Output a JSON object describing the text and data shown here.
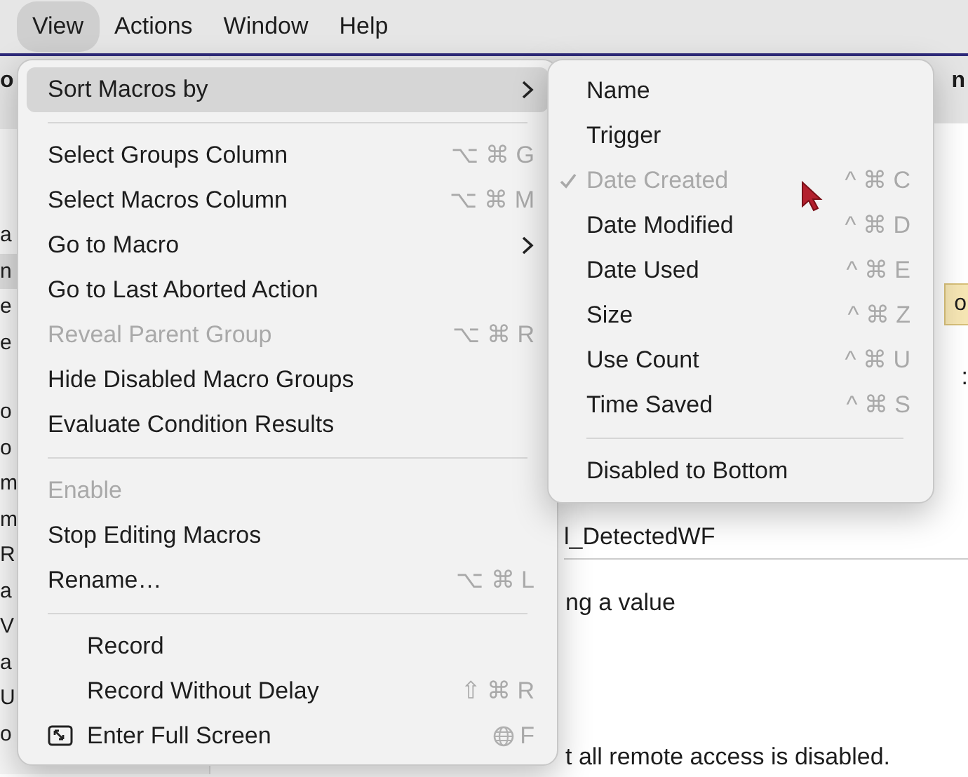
{
  "menu_bar": [
    {
      "label": "View",
      "selected": true
    },
    {
      "label": "Actions",
      "selected": false
    },
    {
      "label": "Window",
      "selected": false
    },
    {
      "label": "Help",
      "selected": false
    }
  ],
  "background": {
    "header_left": "o",
    "header_right": "n",
    "left_rows": [
      {
        "text": "a",
        "selected": false
      },
      {
        "text": "n",
        "selected": true
      },
      {
        "text": "e",
        "selected": false
      },
      {
        "text": "e",
        "selected": false
      },
      {
        "text": "o",
        "selected": false
      },
      {
        "text": "o",
        "selected": false
      },
      {
        "text": "m",
        "selected": false
      },
      {
        "text": "m",
        "selected": false
      },
      {
        "text": "R",
        "selected": false
      },
      {
        "text": "a",
        "selected": false
      },
      {
        "text": "V",
        "selected": false
      },
      {
        "text": "a",
        "selected": false
      },
      {
        "text": "U",
        "selected": false
      },
      {
        "text": "o",
        "selected": false
      }
    ],
    "right_texts": [
      {
        "kind": "highlight",
        "text": "o"
      },
      {
        "kind": "plain",
        "text": ":"
      }
    ],
    "lines": [
      {
        "kind": "field",
        "text": "l_DetectedWF"
      },
      {
        "kind": "text",
        "text": "ng a value"
      },
      {
        "kind": "text",
        "text": "t all remote access is disabled."
      }
    ]
  },
  "view_menu": [
    {
      "kind": "item",
      "label": "Sort Macros by",
      "highlighted": true,
      "submenu": true
    },
    {
      "kind": "separator"
    },
    {
      "kind": "item",
      "label": "Select Groups Column",
      "shortcut": "⌥ ⌘ G"
    },
    {
      "kind": "item",
      "label": "Select Macros Column",
      "shortcut": "⌥ ⌘ M"
    },
    {
      "kind": "item",
      "label": "Go to Macro",
      "submenu": true
    },
    {
      "kind": "item",
      "label": "Go to Last Aborted Action"
    },
    {
      "kind": "item",
      "label": "Reveal Parent Group",
      "shortcut": "⌥ ⌘ R",
      "disabled": true
    },
    {
      "kind": "item",
      "label": "Hide Disabled Macro Groups"
    },
    {
      "kind": "item",
      "label": "Evaluate Condition Results"
    },
    {
      "kind": "separator"
    },
    {
      "kind": "item",
      "label": "Enable",
      "disabled": true
    },
    {
      "kind": "item",
      "label": "Stop Editing Macros"
    },
    {
      "kind": "item",
      "label": "Rename…",
      "shortcut": "⌥ ⌘ L"
    },
    {
      "kind": "separator"
    },
    {
      "kind": "item",
      "label": "Record",
      "indented": true
    },
    {
      "kind": "item",
      "label": "Record Without Delay",
      "shortcut": "⇧ ⌘ R",
      "indented": true
    },
    {
      "kind": "fullscreen",
      "label": "Enter Full Screen",
      "shortcut": "F"
    }
  ],
  "sort_submenu": [
    {
      "kind": "item",
      "label": "Name"
    },
    {
      "kind": "item",
      "label": "Trigger"
    },
    {
      "kind": "item",
      "label": "Date Created",
      "shortcut": "^ ⌘ C",
      "checked": true,
      "disabled": true
    },
    {
      "kind": "item",
      "label": "Date Modified",
      "shortcut": "^ ⌘ D"
    },
    {
      "kind": "item",
      "label": "Date Used",
      "shortcut": "^ ⌘ E"
    },
    {
      "kind": "item",
      "label": "Size",
      "shortcut": "^ ⌘ Z"
    },
    {
      "kind": "item",
      "label": "Use Count",
      "shortcut": "^ ⌘ U"
    },
    {
      "kind": "item",
      "label": "Time Saved",
      "shortcut": "^ ⌘ S"
    },
    {
      "kind": "separator"
    },
    {
      "kind": "item",
      "label": "Disabled to Bottom"
    }
  ]
}
